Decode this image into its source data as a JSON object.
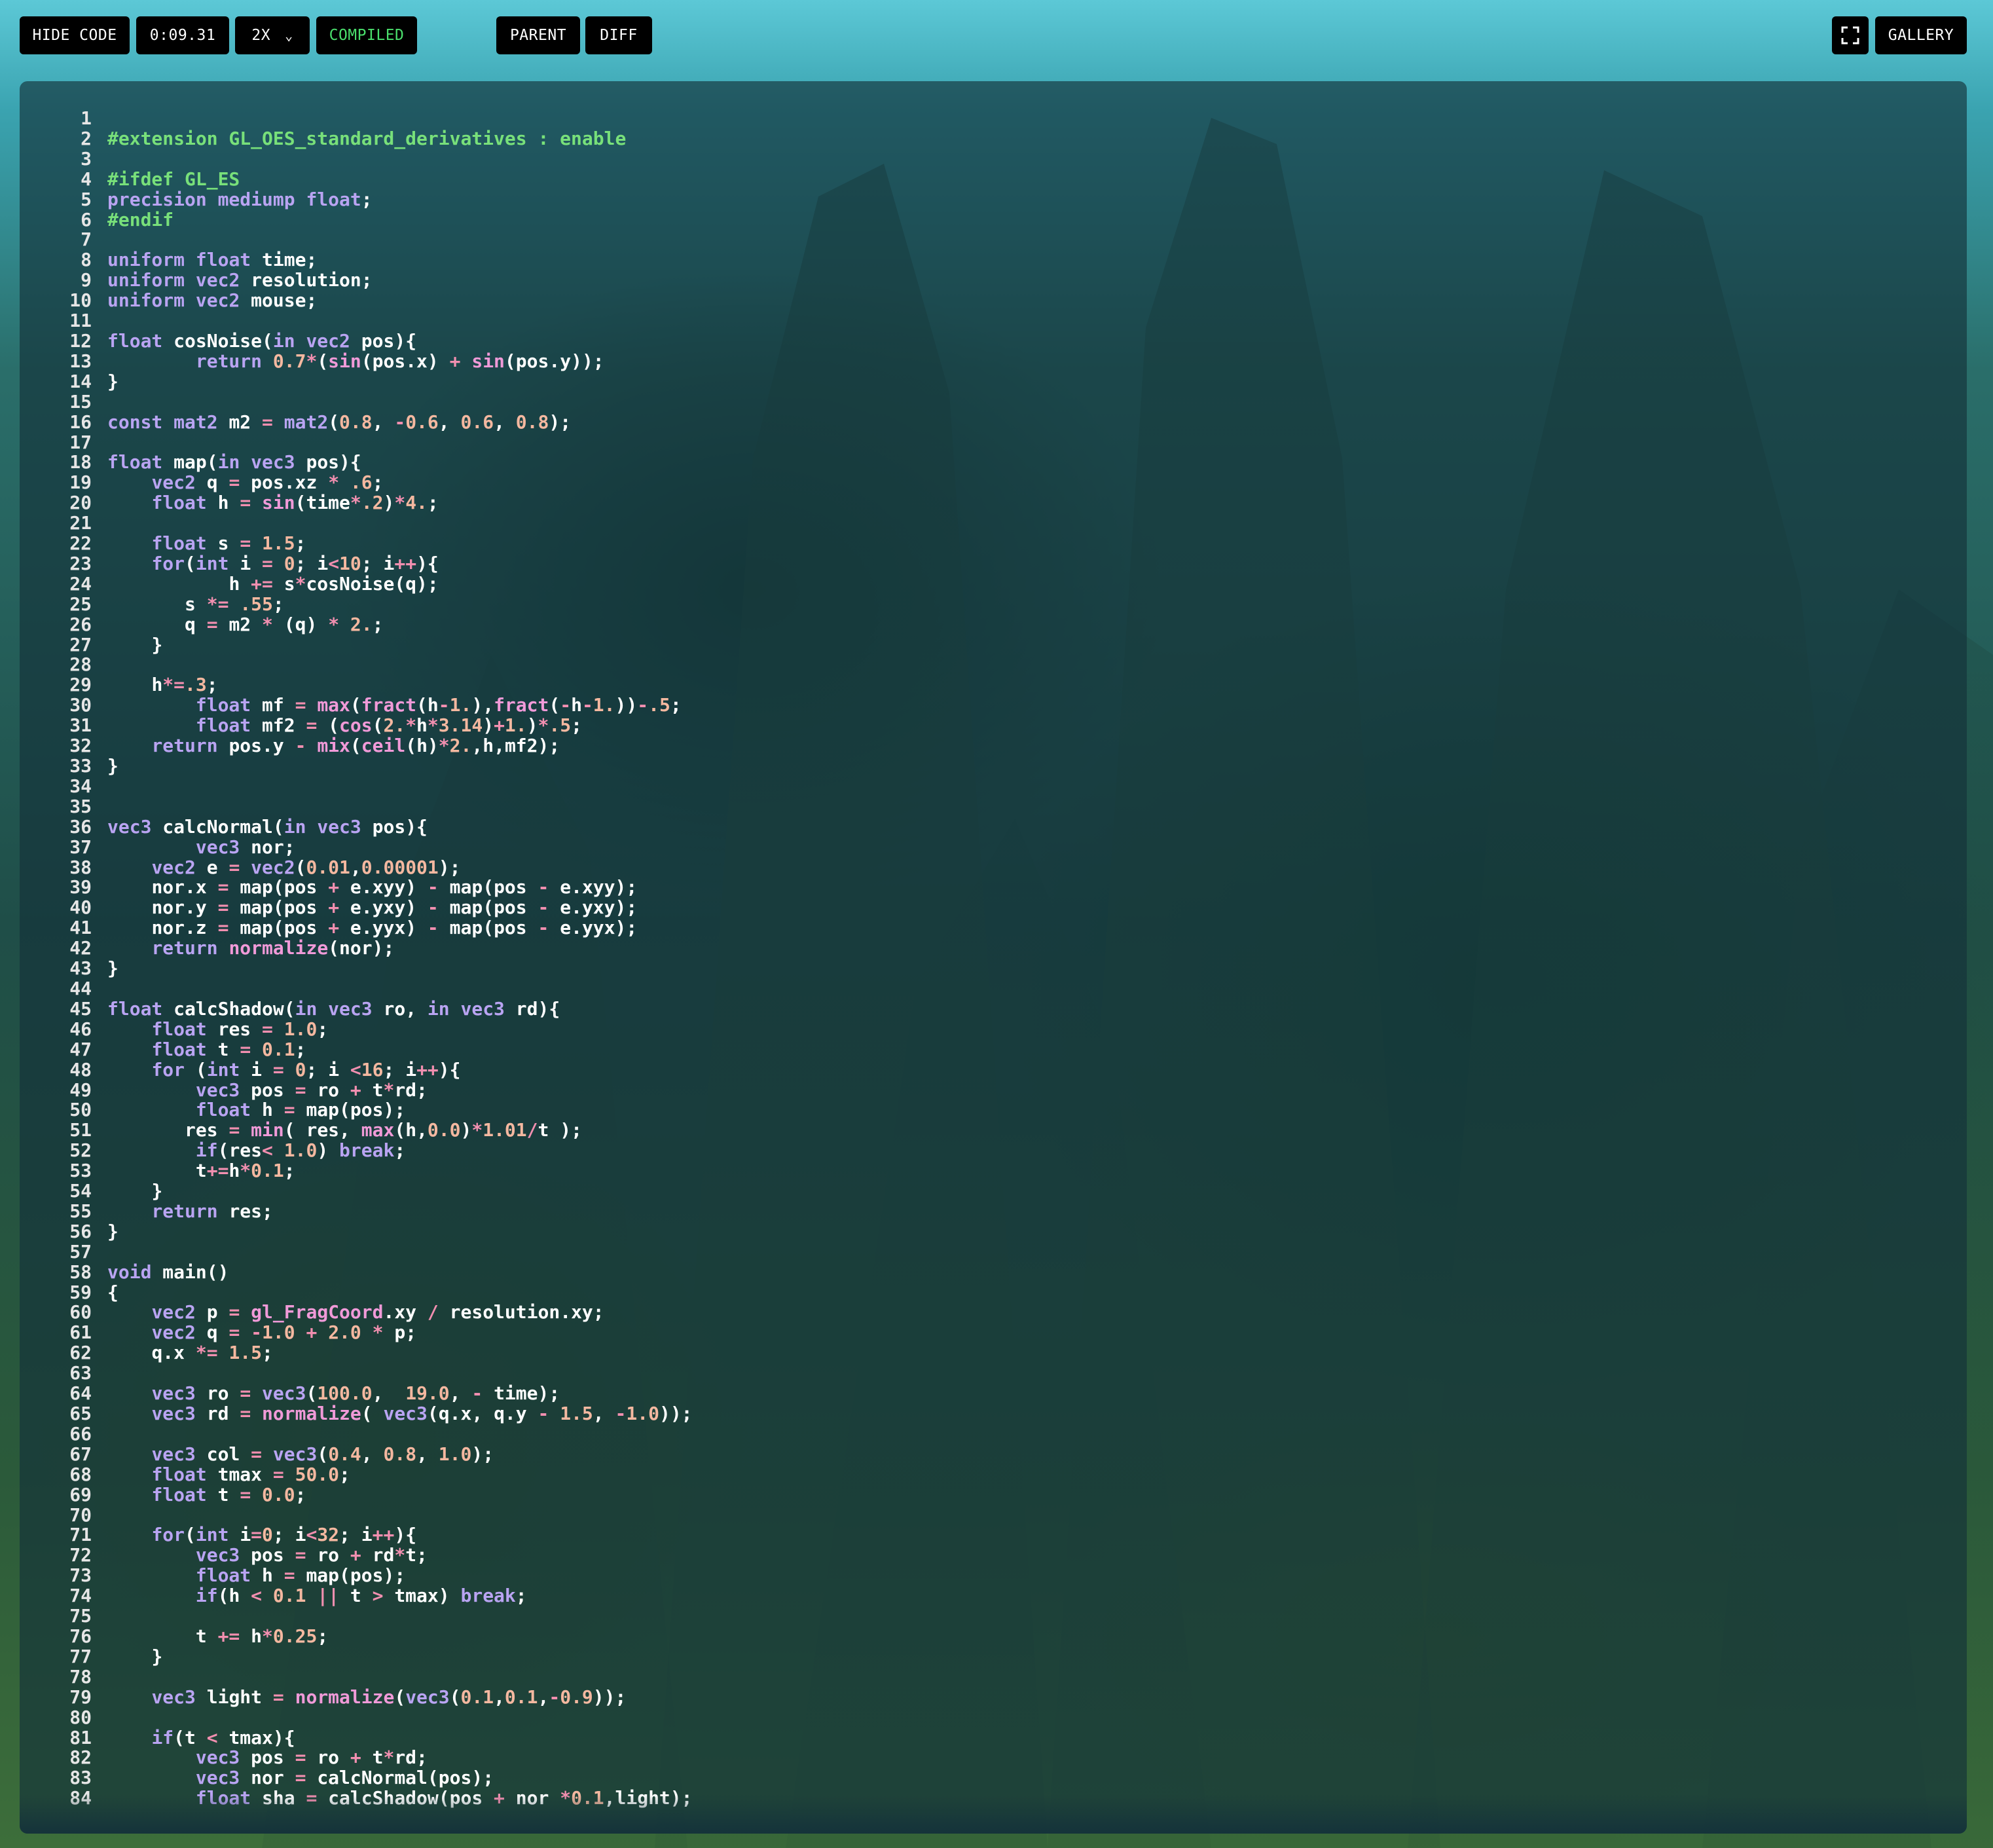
{
  "toolbar": {
    "hide_code_label": "HIDE CODE",
    "timer": "0:09.31",
    "resolution_label": "2X",
    "status_label": "COMPILED",
    "parent_label": "PARENT",
    "diff_label": "DIFF",
    "gallery_label": "GALLERY",
    "fullscreen_icon": "fullscreen-icon",
    "chevron_icon": "chevron-down-icon"
  },
  "colors": {
    "status_compiled": "#4ade6c",
    "keyword": "#b9a4f2",
    "number": "#f4b8a0",
    "operator": "#f28fb0",
    "builtin": "#f09ad8",
    "directive": "#78e07a"
  },
  "code": {
    "lines": [
      "",
      "#extension GL_OES_standard_derivatives : enable",
      "",
      "#ifdef GL_ES",
      "precision mediump float;",
      "#endif",
      "",
      "uniform float time;",
      "uniform vec2 resolution;",
      "uniform vec2 mouse;",
      "",
      "float cosNoise(in vec2 pos){",
      "        return 0.7*(sin(pos.x) + sin(pos.y));",
      "}",
      "",
      "const mat2 m2 = mat2(0.8, -0.6, 0.6, 0.8);",
      "",
      "float map(in vec3 pos){",
      "    vec2 q = pos.xz * .6;",
      "    float h = sin(time*.2)*4.;",
      "",
      "    float s = 1.5;",
      "    for(int i = 0; i<10; i++){",
      "           h += s*cosNoise(q);",
      "       s *= .55;",
      "       q = m2 * (q) * 2.;",
      "    }",
      "",
      "    h*=.3;",
      "        float mf = max(fract(h-1.),fract(-h-1.))-.5;",
      "        float mf2 = (cos(2.*h*3.14)+1.)*.5;",
      "    return pos.y - mix(ceil(h)*2.,h,mf2);",
      "}",
      "",
      "",
      "vec3 calcNormal(in vec3 pos){",
      "        vec3 nor;",
      "    vec2 e = vec2(0.01,0.00001);",
      "    nor.x = map(pos + e.xyy) - map(pos - e.xyy);",
      "    nor.y = map(pos + e.yxy) - map(pos - e.yxy);",
      "    nor.z = map(pos + e.yyx) - map(pos - e.yyx);",
      "    return normalize(nor);",
      "}",
      "",
      "float calcShadow(in vec3 ro, in vec3 rd){",
      "    float res = 1.0;",
      "    float t = 0.1;",
      "    for (int i = 0; i <16; i++){",
      "        vec3 pos = ro + t*rd;",
      "        float h = map(pos);",
      "       res = min( res, max(h,0.0)*1.01/t );",
      "        if(res< 1.0) break;",
      "        t+=h*0.1;",
      "    }",
      "    return res;",
      "}",
      "",
      "void main()",
      "{",
      "    vec2 p = gl_FragCoord.xy / resolution.xy;",
      "    vec2 q = -1.0 + 2.0 * p;",
      "    q.x *= 1.5;",
      "",
      "    vec3 ro = vec3(100.0,  19.0, - time);",
      "    vec3 rd = normalize( vec3(q.x, q.y - 1.5, -1.0));",
      "",
      "    vec3 col = vec3(0.4, 0.8, 1.0);",
      "    float tmax = 50.0;",
      "    float t = 0.0;",
      "",
      "    for(int i=0; i<32; i++){",
      "        vec3 pos = ro + rd*t;",
      "        float h = map(pos);",
      "        if(h < 0.1 || t > tmax) break;",
      "",
      "        t += h*0.25;",
      "    }",
      "",
      "    vec3 light = normalize(vec3(0.1,0.1,-0.9));",
      "",
      "    if(t < tmax){",
      "        vec3 pos = ro + t*rd;",
      "        vec3 nor = calcNormal(pos);",
      "        float sha = calcShadow(pos + nor *0.1,light);"
    ]
  }
}
